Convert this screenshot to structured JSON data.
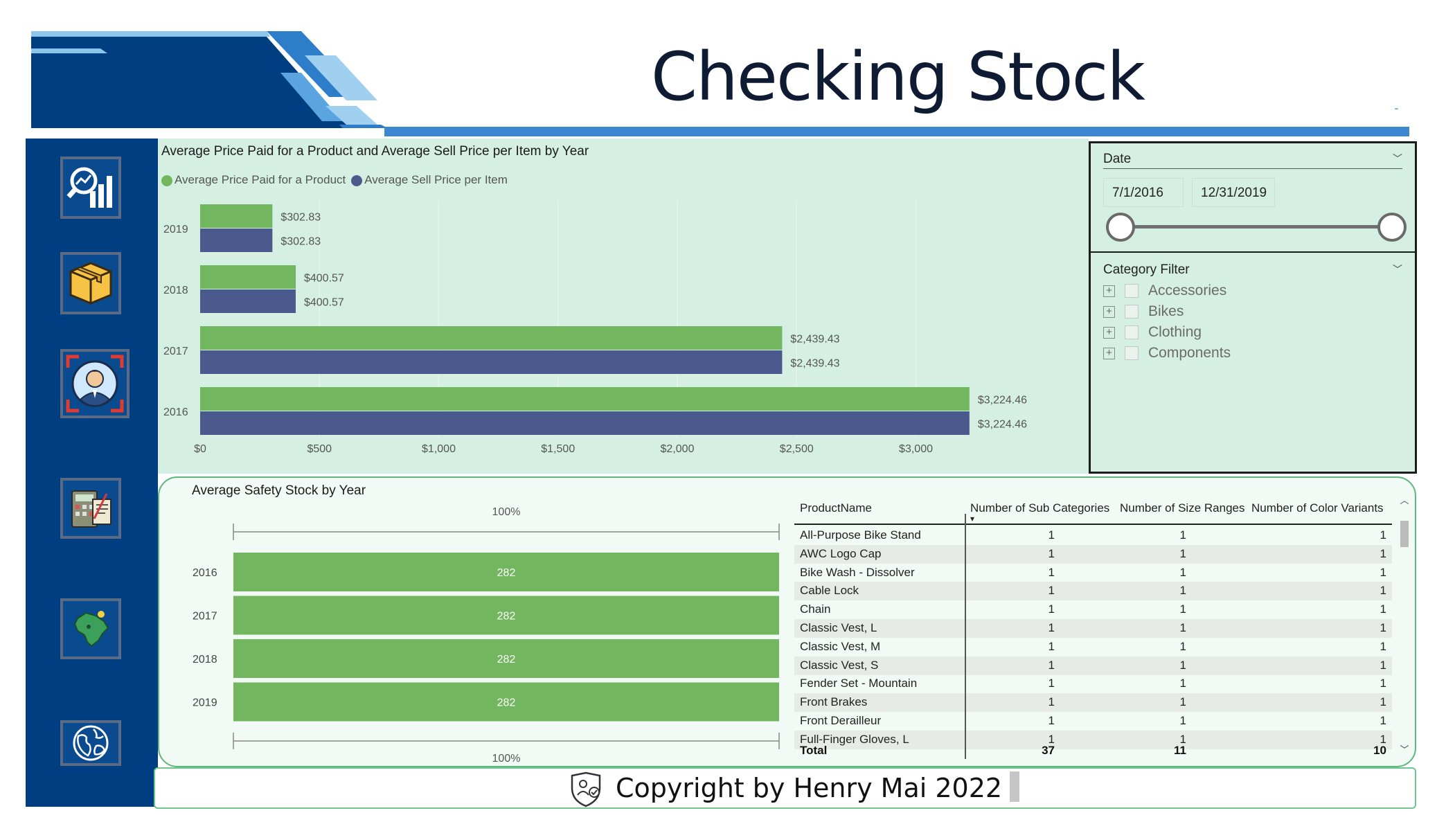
{
  "header": {
    "title": "Checking Stock"
  },
  "sidebar": {
    "items": [
      {
        "icon": "analytics-magnifier-icon"
      },
      {
        "icon": "package-box-icon"
      },
      {
        "icon": "employee-target-icon"
      },
      {
        "icon": "calculator-finance-icon"
      },
      {
        "icon": "brazil-map-icon"
      },
      {
        "icon": "globe-icon"
      }
    ]
  },
  "price_chart": {
    "title": "Average Price Paid for a Product and Average Sell Price per Item by Year",
    "legend": [
      "Average Price Paid for a Product",
      "Average Sell Price per Item"
    ],
    "colors": {
      "paid": "#72b65f",
      "sell": "#4a5a8c"
    }
  },
  "safety_chart": {
    "title": "Average Safety Stock by Year",
    "top_label": "100%",
    "bottom_label": "100%",
    "bar_color": "#72b65f"
  },
  "chart_data": [
    {
      "type": "bar",
      "orientation": "horizontal",
      "title": "Average Price Paid for a Product and Average Sell Price per Item by Year",
      "categories": [
        "2019",
        "2018",
        "2017",
        "2016"
      ],
      "series": [
        {
          "name": "Average Price Paid for a Product",
          "values": [
            302.83,
            400.57,
            2439.43,
            3224.46
          ],
          "labels": [
            "$302.83",
            "$400.57",
            "$2,439.43",
            "$3,224.46"
          ]
        },
        {
          "name": "Average Sell Price per Item",
          "values": [
            302.83,
            400.57,
            2439.43,
            3224.46
          ],
          "labels": [
            "$302.83",
            "$400.57",
            "$2,439.43",
            "$3,224.46"
          ]
        }
      ],
      "xticks": [
        "$0",
        "$500",
        "$1,000",
        "$1,500",
        "$2,000",
        "$2,500",
        "$3,000"
      ],
      "xtick_values": [
        0,
        500,
        1000,
        1500,
        2000,
        2500,
        3000
      ],
      "xlim": [
        0,
        3550
      ],
      "grid": true,
      "legend_position": "top-left"
    },
    {
      "type": "bar",
      "orientation": "horizontal",
      "title": "Average Safety Stock by Year",
      "categories": [
        "2016",
        "2017",
        "2018",
        "2019"
      ],
      "values": [
        282,
        282,
        282,
        282
      ],
      "labels": [
        "282",
        "282",
        "282",
        "282"
      ],
      "scale_labels": [
        "100%",
        "100%"
      ]
    }
  ],
  "slicers": {
    "date": {
      "label": "Date",
      "start": "7/1/2016",
      "end": "12/31/2019"
    },
    "category": {
      "label": "Category Filter",
      "items": [
        "Accessories",
        "Bikes",
        "Clothing",
        "Components"
      ]
    }
  },
  "table": {
    "columns": [
      "ProductName",
      "Number of Sub Categories",
      "Number of Size Ranges",
      "Number of Color Variants"
    ],
    "rows": [
      [
        "All-Purpose Bike Stand",
        "1",
        "1",
        "1"
      ],
      [
        "AWC Logo Cap",
        "1",
        "1",
        "1"
      ],
      [
        "Bike Wash - Dissolver",
        "1",
        "1",
        "1"
      ],
      [
        "Cable Lock",
        "1",
        "1",
        "1"
      ],
      [
        "Chain",
        "1",
        "1",
        "1"
      ],
      [
        "Classic Vest, L",
        "1",
        "1",
        "1"
      ],
      [
        "Classic Vest, M",
        "1",
        "1",
        "1"
      ],
      [
        "Classic Vest, S",
        "1",
        "1",
        "1"
      ],
      [
        "Fender Set - Mountain",
        "1",
        "1",
        "1"
      ],
      [
        "Front Brakes",
        "1",
        "1",
        "1"
      ],
      [
        "Front Derailleur",
        "1",
        "1",
        "1"
      ],
      [
        "Full-Finger Gloves, L",
        "1",
        "1",
        "1"
      ]
    ],
    "total": [
      "Total",
      "37",
      "11",
      "10"
    ],
    "sort_indicator": "▾"
  },
  "footer": {
    "text": "Copyright by Henry Mai 2022"
  }
}
